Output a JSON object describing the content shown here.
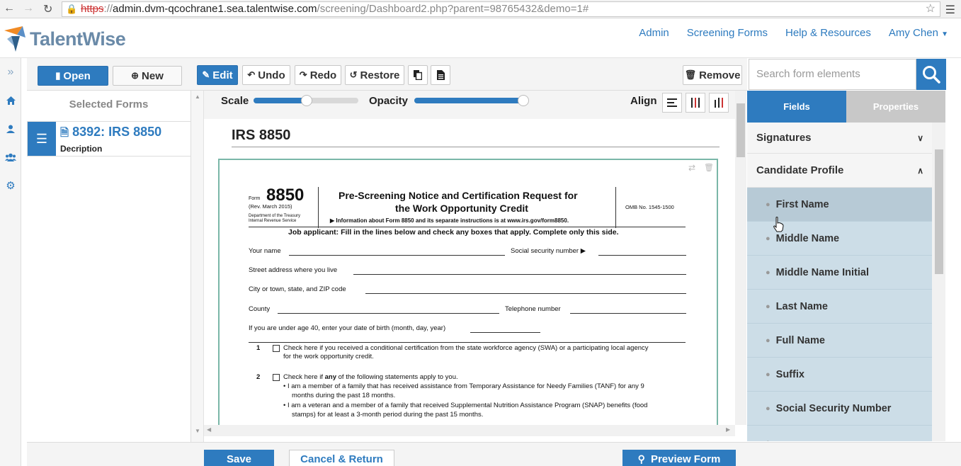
{
  "browser": {
    "url_scheme": "https",
    "url_host": "admin.dvm-qcochrane1.sea.talentwise.com",
    "url_path": "/screening/Dashboard2.php?parent=98765432&demo=1#"
  },
  "header": {
    "logo_text": "TalentWise",
    "links": [
      "Admin",
      "Screening Forms",
      "Help & Resources",
      "Amy Chen"
    ]
  },
  "toolbar": {
    "open_label": "Open",
    "new_label": "New",
    "edit_label": "Edit",
    "undo_label": "Undo",
    "redo_label": "Redo",
    "restore_label": "Restore",
    "remove_label": "Remove"
  },
  "search": {
    "placeholder": "Search form elements"
  },
  "selected_forms": {
    "title": "Selected Forms",
    "item_name": "8392: IRS 8850",
    "item_desc": "Decription"
  },
  "canvas": {
    "scale_label": "Scale",
    "scale_value": 0.51,
    "opacity_label": "Opacity",
    "opacity_value": 0.98,
    "align_label": "Align",
    "form_title": "IRS 8850"
  },
  "document": {
    "form_word": "Form",
    "form_number": "8850",
    "rev": "(Rev. March 2015)",
    "dept": "Department of the Treasury",
    "irs": "Internal Revenue Service",
    "heading_line1": "Pre-Screening Notice and Certification Request for",
    "heading_line2": "the Work Opportunity Credit",
    "info_line": "▶ Information about Form 8850 and its separate instructions is at www.irs.gov/form8850.",
    "omb": "OMB No. 1545-1500",
    "job_line": "Job applicant: Fill in the lines below and check any boxes that apply. Complete only this side.",
    "your_name": "Your name",
    "ssn": "Social security number ▶",
    "street": "Street address where you live",
    "city": "City or town, state, and ZIP code",
    "county": "County",
    "telephone": "Telephone number",
    "dob": "If you are under age 40, enter your date of birth (month, day, year)",
    "item1_num": "1",
    "item1_line1": "Check here if you received a conditional certification from the state workforce agency (SWA) or a participating local agency",
    "item1_line2": "for the work opportunity credit.",
    "item2_num": "2",
    "item2_pre": "Check here if ",
    "item2_bold": "any",
    "item2_post": " of the following statements apply to you.",
    "bullet1_line1": "•  I am a member of a family that has received assistance from Temporary Assistance for Needy Families (TANF) for any 9",
    "bullet1_line2": "months during the past 18 months.",
    "bullet2_line1": "•  I am a veteran and a member of a family that received Supplemental Nutrition Assistance Program (SNAP) benefits (food",
    "bullet2_line2": "stamps) for at least a 3-month period during the past 15 months."
  },
  "right_panel": {
    "tab_fields": "Fields",
    "tab_properties": "Properties",
    "section_signatures": "Signatures",
    "section_candidate": "Candidate Profile",
    "fields": [
      "First Name",
      "Middle Name",
      "Middle Name Initial",
      "Last Name",
      "Full Name",
      "Suffix",
      "Social Security Number"
    ]
  },
  "bottom": {
    "save_label": "Save",
    "cancel_label": "Cancel & Return",
    "preview_label": "Preview Form"
  },
  "colors": {
    "accent": "#2e7bbf",
    "field_bg": "#ccdde7"
  }
}
